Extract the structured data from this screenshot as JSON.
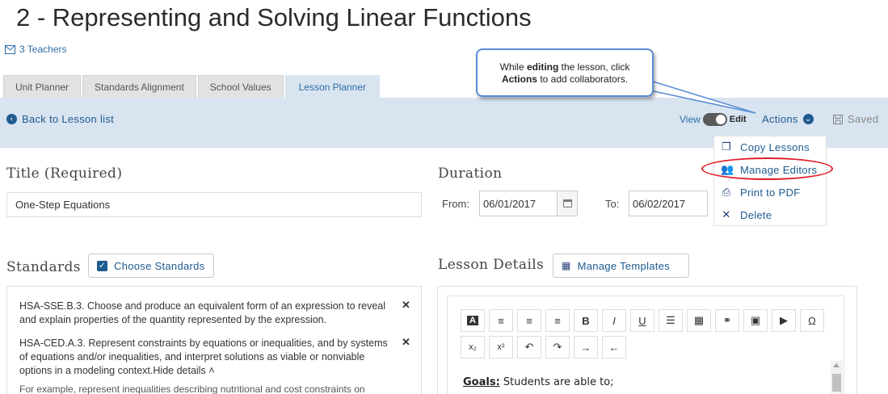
{
  "page": {
    "title": "2 - Representing and Solving Linear Functions",
    "teachers_link": "3 Teachers"
  },
  "tabs": [
    {
      "label": "Unit Planner",
      "active": false
    },
    {
      "label": "Standards Alignment",
      "active": false
    },
    {
      "label": "School Values",
      "active": false
    },
    {
      "label": "Lesson Planner",
      "active": true
    }
  ],
  "toolbar": {
    "back_label": "Back to Lesson list",
    "view_label": "View",
    "edit_label": "Edit",
    "actions_label": "Actions",
    "saved_label": "Saved"
  },
  "callout": {
    "line1_prefix": "While",
    "line1_bold": "editing",
    "line1_suffix": "the lesson, click",
    "line2_bold": "Actions",
    "line2_suffix": "to add collaborators."
  },
  "actions_menu": {
    "items": [
      {
        "label": "Copy Lessons",
        "icon": "copy-icon"
      },
      {
        "label": "Manage Editors",
        "icon": "users-icon",
        "highlighted": true
      },
      {
        "label": "Print to PDF",
        "icon": "print-icon"
      },
      {
        "label": "Delete",
        "icon": "close-icon"
      }
    ]
  },
  "title_field": {
    "label": "Title (Required)",
    "value": "One-Step Equations"
  },
  "duration": {
    "label": "Duration",
    "from_label": "From:",
    "from_value": "06/01/2017",
    "to_label": "To:",
    "to_value": "06/02/2017"
  },
  "standards": {
    "label": "Standards",
    "choose_button": "Choose Standards",
    "items": [
      {
        "text": "HSA-SSE.B.3. Choose and produce an equivalent form of an expression to reveal and explain properties of the quantity represented by the expression."
      },
      {
        "text": "HSA-CED.A.3. Represent constraints by equations or inequalities, and by systems of equations and/or inequalities, and interpret solutions as viable or nonviable options in a modeling context.",
        "hide_link": "Hide details"
      }
    ],
    "detail_text": "For example, represent inequalities describing nutritional and cost constraints on"
  },
  "lesson_details": {
    "label": "Lesson Details",
    "manage_templates_button": "Manage Templates",
    "editor_goals_label": "Goals:",
    "editor_goals_text": "Students are able to;"
  },
  "colors": {
    "accent": "#1f5b8f",
    "band": "#d8e4f0",
    "callout_border": "#5b8dd6",
    "highlight_ring": "#e0202a"
  }
}
